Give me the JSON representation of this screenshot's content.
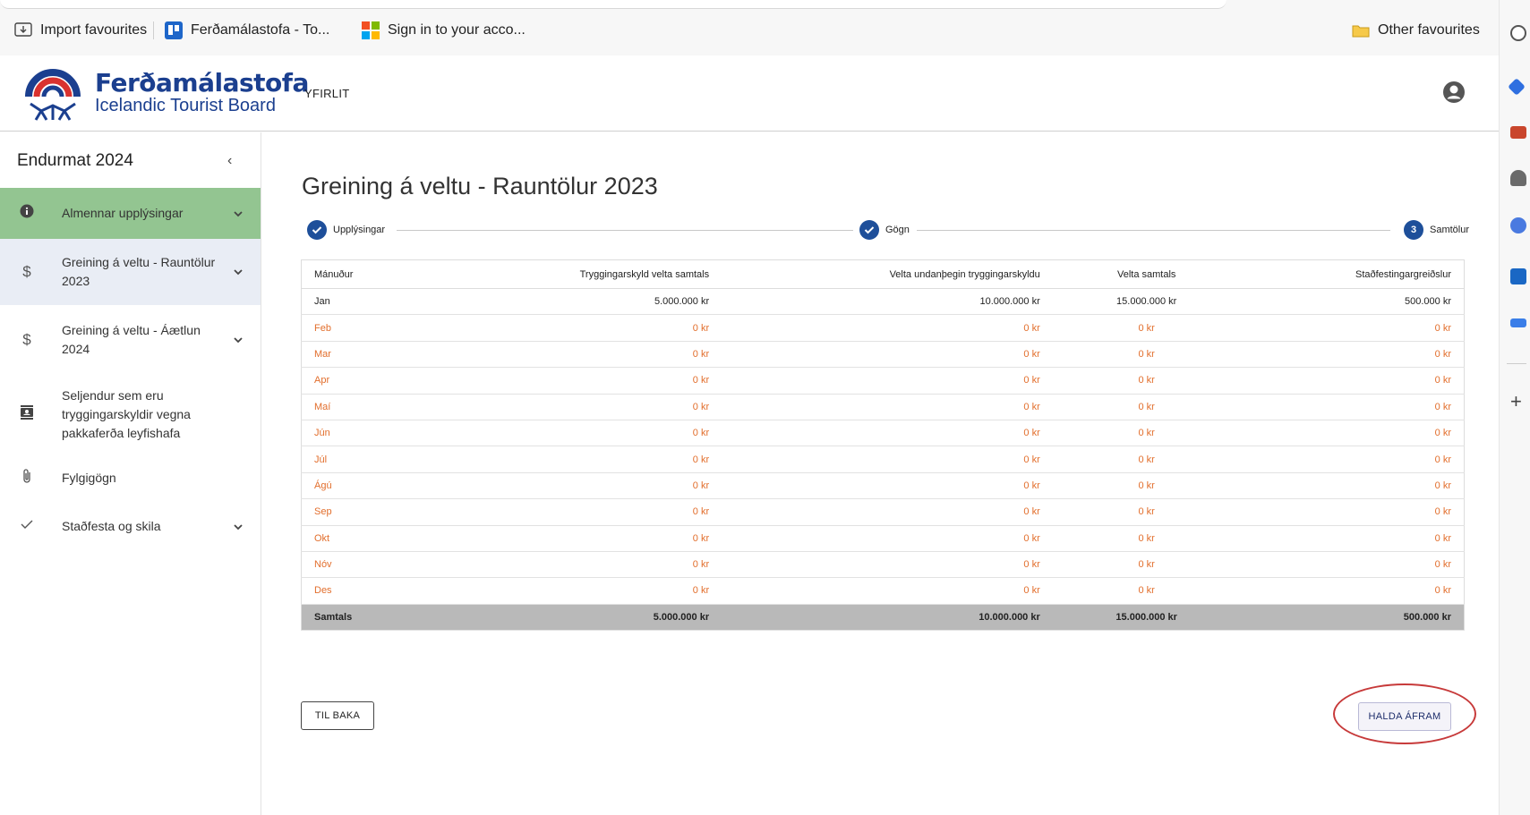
{
  "browser": {
    "favourites": [
      {
        "label": "Import favourites",
        "icon": "import-icon"
      },
      {
        "label": "Ferðamálastofa - To...",
        "icon": "trello-icon"
      },
      {
        "label": "Sign in to your acco...",
        "icon": "microsoft-icon"
      }
    ],
    "other_favourites": "Other favourites"
  },
  "header": {
    "brand_name": "Ferðamálastofa",
    "brand_sub": "Icelandic Tourist Board",
    "nav_overview": "YFIRLIT",
    "user_icon": "account-icon"
  },
  "sidebar": {
    "title": "Endurmat 2024",
    "collapse_icon": "chevron-left-icon",
    "items": [
      {
        "label": "Almennar upplýsingar",
        "icon": "info-icon",
        "expandable": true,
        "state": "complete"
      },
      {
        "label": "Greining á veltu - Rauntölur 2023",
        "icon": "dollar-icon",
        "expandable": true,
        "state": "current"
      },
      {
        "label": "Greining á veltu - Áætlun 2024",
        "icon": "dollar-icon",
        "expandable": true
      },
      {
        "label": "Seljendur sem eru tryggingarskyldir vegna pakkaferða leyfishafa",
        "icon": "contact-card-icon",
        "expandable": false
      },
      {
        "label": "Fylgigögn",
        "icon": "paperclip-icon",
        "expandable": false
      },
      {
        "label": "Staðfesta og skila",
        "icon": "checkmark-icon",
        "expandable": true
      }
    ]
  },
  "main": {
    "title": "Greining á veltu - Rauntölur 2023",
    "steps": [
      {
        "label": "Upplýsingar",
        "status": "done"
      },
      {
        "label": "Gögn",
        "status": "done"
      },
      {
        "label": "Samtölur",
        "status": "active",
        "number": "3"
      }
    ],
    "table": {
      "headers": [
        "Mánuður",
        "Tryggingarskyld velta samtals",
        "Velta undanþegin tryggingarskyldu",
        "Velta samtals",
        "Staðfestingargreiðslur"
      ],
      "rows": [
        [
          "Jan",
          "5.000.000 kr",
          "10.000.000 kr",
          "15.000.000 kr",
          "500.000 kr"
        ],
        [
          "Feb",
          "0 kr",
          "0 kr",
          "0 kr",
          "0 kr"
        ],
        [
          "Mar",
          "0 kr",
          "0 kr",
          "0 kr",
          "0 kr"
        ],
        [
          "Apr",
          "0 kr",
          "0 kr",
          "0 kr",
          "0 kr"
        ],
        [
          "Maí",
          "0 kr",
          "0 kr",
          "0 kr",
          "0 kr"
        ],
        [
          "Jún",
          "0 kr",
          "0 kr",
          "0 kr",
          "0 kr"
        ],
        [
          "Júl",
          "0 kr",
          "0 kr",
          "0 kr",
          "0 kr"
        ],
        [
          "Ágú",
          "0 kr",
          "0 kr",
          "0 kr",
          "0 kr"
        ],
        [
          "Sep",
          "0 kr",
          "0 kr",
          "0 kr",
          "0 kr"
        ],
        [
          "Okt",
          "0 kr",
          "0 kr",
          "0 kr",
          "0 kr"
        ],
        [
          "Nóv",
          "0 kr",
          "0 kr",
          "0 kr",
          "0 kr"
        ],
        [
          "Des",
          "0 kr",
          "0 kr",
          "0 kr",
          "0 kr"
        ]
      ],
      "total": [
        "Samtals",
        "5.000.000 kr",
        "10.000.000 kr",
        "15.000.000 kr",
        "500.000 kr"
      ]
    },
    "back_label": "TIL BAKA",
    "next_label": "HALDA ÁFRAM"
  },
  "colors": {
    "brand_blue": "#1b3f8f",
    "step_blue": "#1e4f9a",
    "zero_orange": "#e26e2c",
    "sidebar_complete": "#93c591",
    "sidebar_current": "#e9edf5",
    "total_row": "#b9b9b9",
    "highlight_ring": "#c73a3a"
  }
}
